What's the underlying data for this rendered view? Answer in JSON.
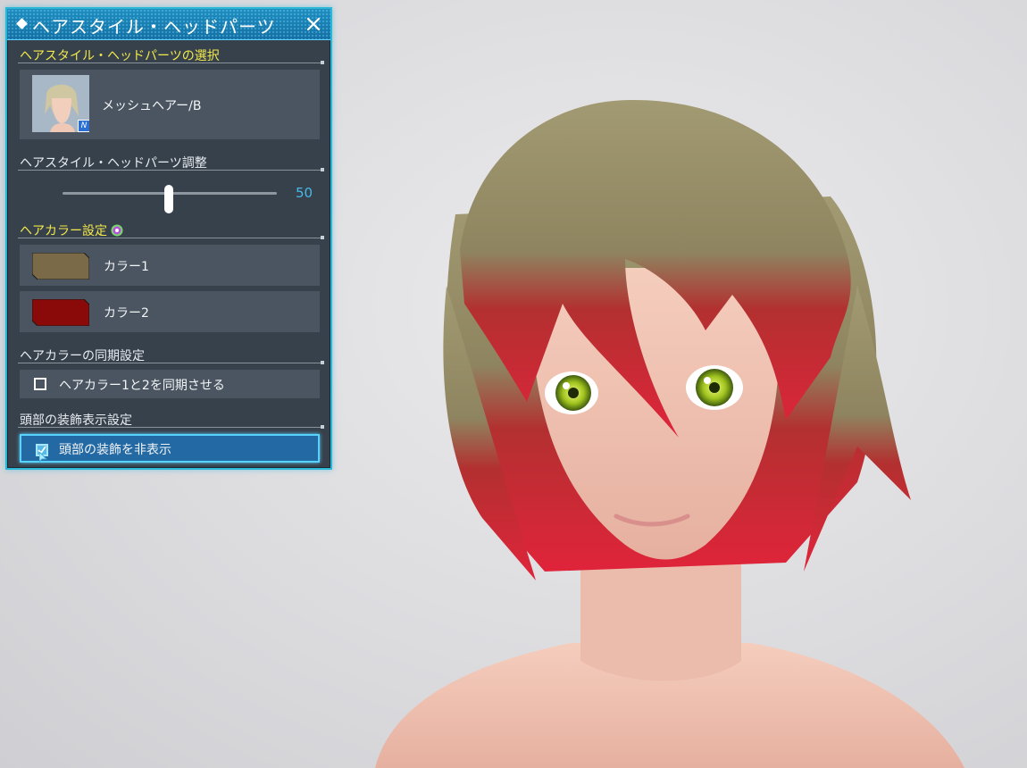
{
  "panel": {
    "title": "ヘアスタイル・ヘッドパーツ",
    "sections": {
      "select": {
        "label": "ヘアスタイル・ヘッドパーツの選択",
        "item_name": "メッシュヘアー/B",
        "badge": "N"
      },
      "adjust": {
        "label": "ヘアスタイル・ヘッドパーツ調整",
        "value": "50"
      },
      "color": {
        "label": "ヘアカラー設定",
        "color1_label": "カラー1",
        "color2_label": "カラー2",
        "color1_hex": "#7a6a48",
        "color2_hex": "#8a0a0a"
      },
      "sync": {
        "label": "ヘアカラーの同期設定",
        "checkbox_label": "ヘアカラー1と2を同期させる",
        "checked": false
      },
      "head_deco": {
        "label": "頭部の装飾表示設定",
        "checkbox_label": "頭部の装飾を非表示",
        "checked": true
      }
    }
  },
  "colors": {
    "accent": "#2bb6d6",
    "panel_bg": "#37414c",
    "row_bg": "#4a5561",
    "section_yellow": "#f2e84a",
    "selected_bg": "#2369a4"
  }
}
